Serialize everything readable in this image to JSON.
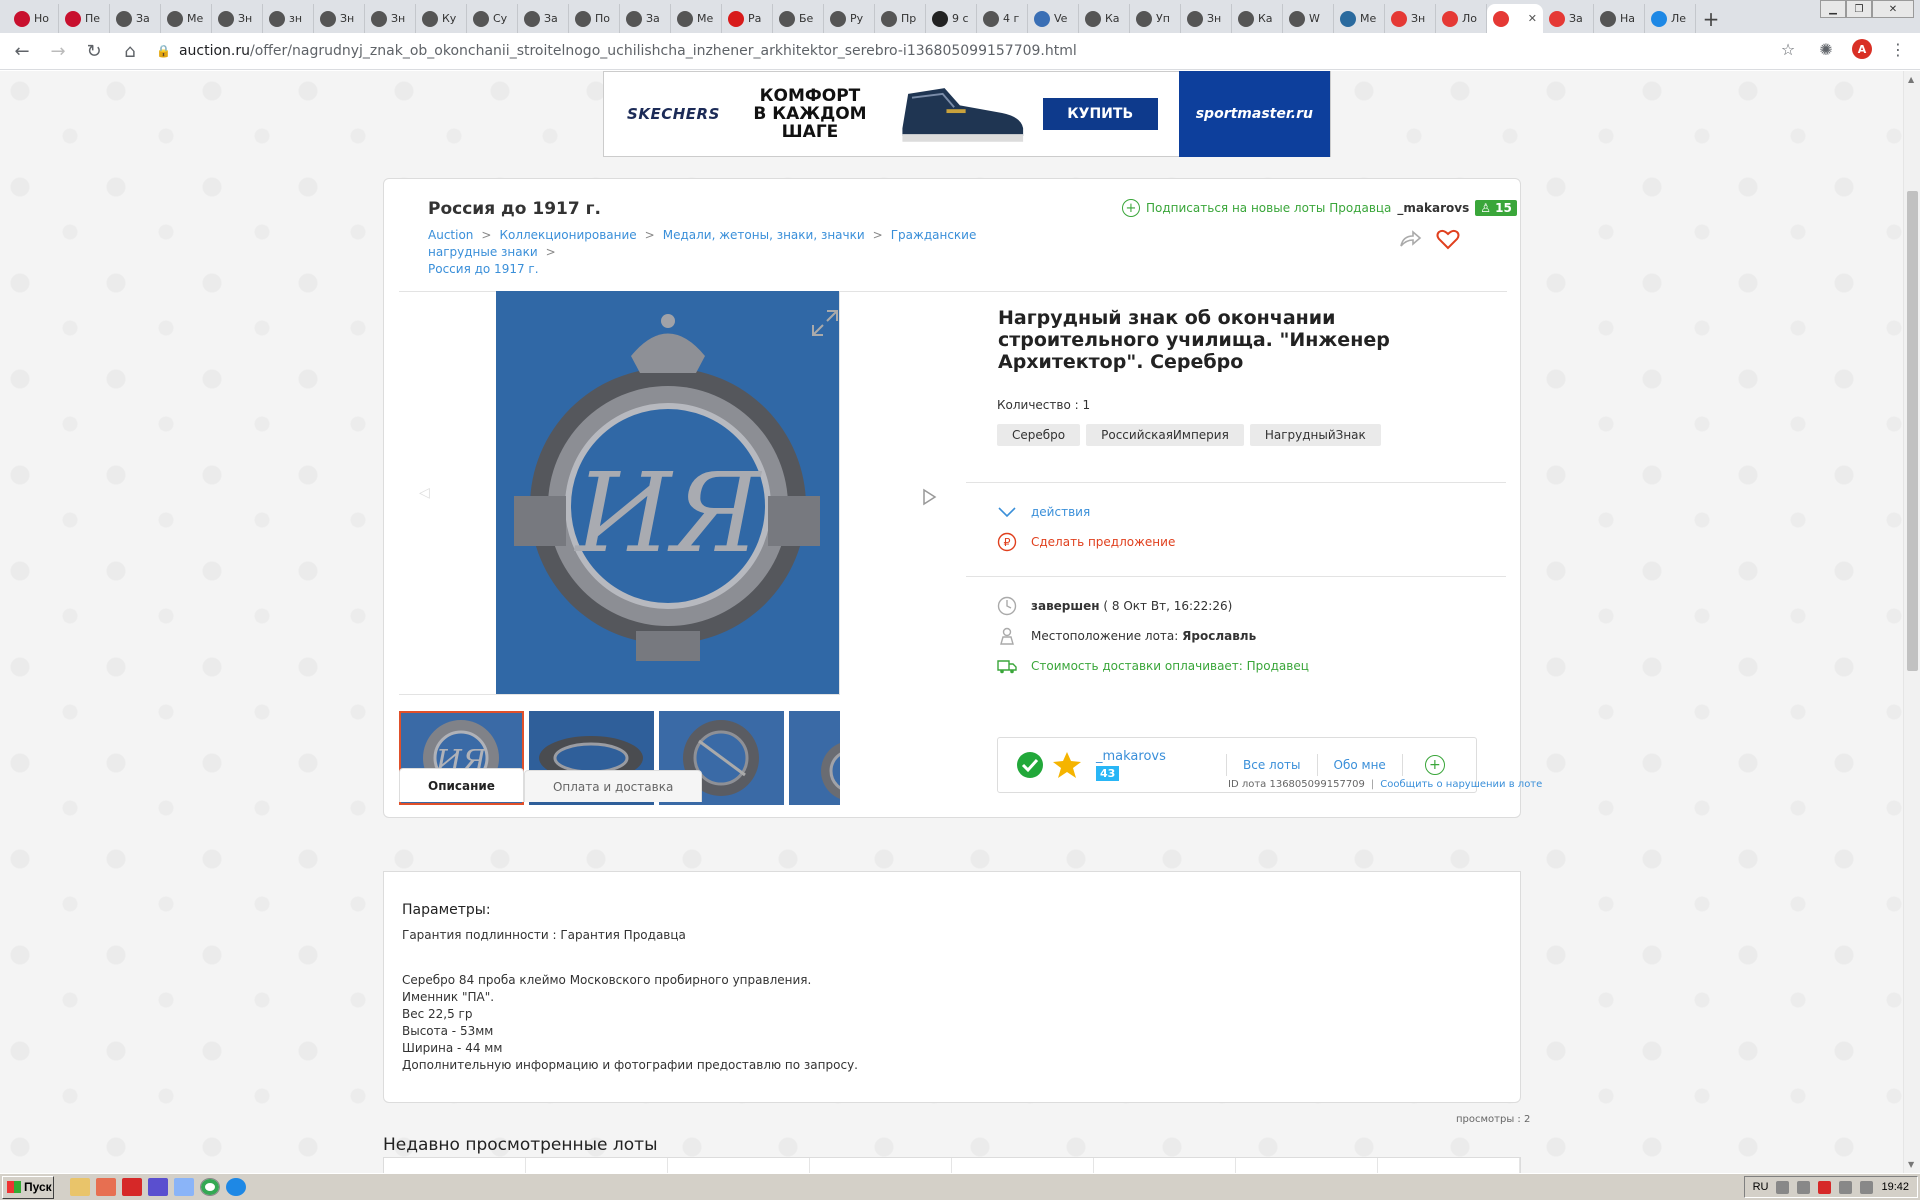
{
  "browser": {
    "tabs": [
      {
        "label": "Но",
        "icon": "avito-a-icon",
        "color": "#c8102e"
      },
      {
        "label": "Пе",
        "icon": "avito-a-icon",
        "color": "#c8102e"
      },
      {
        "label": "За",
        "icon": "chrome-globe-icon",
        "color": "#555555"
      },
      {
        "label": "Ме",
        "icon": "chrome-globe-icon",
        "color": "#555555"
      },
      {
        "label": "Зн",
        "icon": "chrome-globe-icon",
        "color": "#555555"
      },
      {
        "label": "зн",
        "icon": "chrome-globe-icon",
        "color": "#555555"
      },
      {
        "label": "Зн",
        "icon": "chrome-globe-icon",
        "color": "#555555"
      },
      {
        "label": "Зн",
        "icon": "chrome-globe-icon",
        "color": "#555555"
      },
      {
        "label": "Ку",
        "icon": "chrome-globe-icon",
        "color": "#555555"
      },
      {
        "label": "Су",
        "icon": "chrome-globe-icon",
        "color": "#555555"
      },
      {
        "label": "За",
        "icon": "chrome-globe-icon",
        "color": "#555555"
      },
      {
        "label": "По",
        "icon": "chrome-globe-icon",
        "color": "#555555"
      },
      {
        "label": "За",
        "icon": "chrome-globe-icon",
        "color": "#555555"
      },
      {
        "label": "Ме",
        "icon": "chrome-globe-icon",
        "color": "#555555"
      },
      {
        "label": "Ра",
        "icon": "mh-icon",
        "color": "#d81b1b"
      },
      {
        "label": "Бе",
        "icon": "chrome-globe-icon",
        "color": "#555555"
      },
      {
        "label": "Ру",
        "icon": "chrome-globe-icon",
        "color": "#555555"
      },
      {
        "label": "Пр",
        "icon": "chrome-globe-icon",
        "color": "#555555"
      },
      {
        "label": "9 с",
        "icon": "plus-square-icon",
        "color": "#222222"
      },
      {
        "label": "4 г",
        "icon": "chrome-globe-icon",
        "color": "#555555"
      },
      {
        "label": "Ve",
        "icon": "vk-car-icon",
        "color": "#3a6fb5"
      },
      {
        "label": "Ка",
        "icon": "chrome-globe-icon",
        "color": "#555555"
      },
      {
        "label": "Уп",
        "icon": "chrome-globe-icon",
        "color": "#555555"
      },
      {
        "label": "Зн",
        "icon": "cross-icon",
        "color": "#555555"
      },
      {
        "label": "Ка",
        "icon": "chrome-globe-icon",
        "color": "#555555"
      },
      {
        "label": "W",
        "icon": "chrome-globe-icon",
        "color": "#555555"
      },
      {
        "label": "Ме",
        "icon": "tree-icon",
        "color": "#2a6a9e"
      },
      {
        "label": "Зн",
        "icon": "auction-a-icon",
        "color": "#e53935"
      },
      {
        "label": "Ло",
        "icon": "auction-a-icon",
        "color": "#e53935"
      },
      {
        "label": "",
        "icon": "auction-a-icon",
        "color": "#e53935",
        "active": true
      },
      {
        "label": "За",
        "icon": "auction-a-icon",
        "color": "#e53935"
      },
      {
        "label": "На",
        "icon": "cross-icon",
        "color": "#555555"
      },
      {
        "label": "Ле",
        "icon": "bird-icon",
        "color": "#1e88e5"
      }
    ],
    "url_host": "auction.ru",
    "url_path": "/offer/nagrudnyj_znak_ob_okonchanii_stroitelnogo_uchilishcha_inzhener_arkhitektor_serebro-i136805099157709.html",
    "profile_letter": "A"
  },
  "banner": {
    "brand": "SKECHERS",
    "slogan": [
      "КОМФОРТ",
      "В КАЖДОМ",
      "ШАГЕ"
    ],
    "buy": "КУПИТЬ",
    "shop": "sportmaster.ru"
  },
  "lot": {
    "category_title": "Россия до 1917 г.",
    "breadcrumb": [
      "Auction",
      "Коллекционирование",
      "Медали, жетоны, знаки, значки",
      "Гражданские нагрудные знаки",
      "Россия до 1917 г."
    ],
    "subscribe_text": "Подписаться на новые лоты Продавца",
    "seller": "_makarovs",
    "seller_followers": "15",
    "title": "Нагрудный знак об окончании строительного училища. \"Инженер Архитектор\". Серебро",
    "quantity": "Количество : 1",
    "tags": [
      "Серебро",
      "РоссийскаяИмперия",
      "НагрудныйЗнак"
    ],
    "actions_label": "действия",
    "offer_label": "Сделать предложение",
    "status_label": "завершен",
    "status_date": "( 8 Окт Вт, 16:22:26)",
    "location_label": "Местоположение лота:",
    "location_value": "Ярославль",
    "shipping": "Стоимость доставки оплачивает: Продавец",
    "seller_rating": "43",
    "all_lots": "Все лоты",
    "about_me": "Обо мне",
    "photo_monogram": "ИЯ"
  },
  "details": {
    "tabs": [
      "Описание",
      "Оплата и доставка"
    ],
    "lot_id": "ID лота 136805099157709",
    "report": "Сообщить о нарушении в лоте",
    "params_heading": "Параметры:",
    "guarantee": "Гарантия подлинности : Гарантия Продавца",
    "description": "Серебро 84 проба клеймо Московского пробирного управления.\nИменник \"ПА\".\nВес 22,5 гр\nВысота - 53мм\nШирина - 44 мм\nДополнительную информацию и фотографии предоставлю по запросу.",
    "views": "просмотры : 2",
    "recent_heading": "Недавно просмотренные лоты"
  },
  "taskbar": {
    "start": "Пуск",
    "lang": "RU",
    "time": "19:42"
  },
  "colors": {
    "link": "#3a8fd9",
    "green": "#3aa63a",
    "red": "#e0401e"
  }
}
